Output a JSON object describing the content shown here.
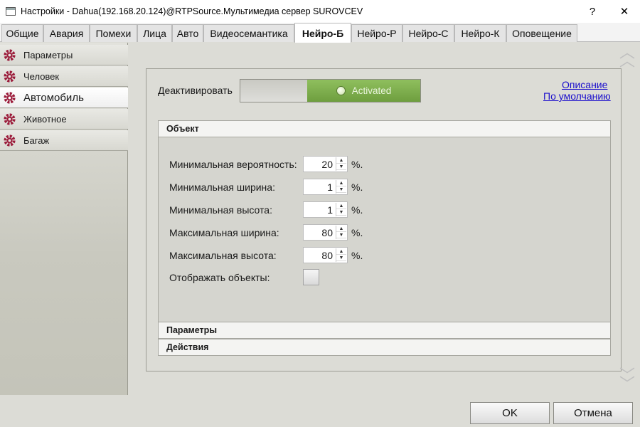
{
  "window": {
    "title": "Настройки - Dahua(192.168.20.124)@RTPSource.Мультимедиа сервер SUROVCEV",
    "help_label": "?",
    "close_label": "✕"
  },
  "tabs": [
    {
      "label": "Общие"
    },
    {
      "label": "Авария"
    },
    {
      "label": "Помехи"
    },
    {
      "label": "Лица"
    },
    {
      "label": "Авто"
    },
    {
      "label": "Видеосемантика"
    },
    {
      "label": "Нейро-Б",
      "active": true
    },
    {
      "label": "Нейро-Р"
    },
    {
      "label": "Нейро-С"
    },
    {
      "label": "Нейро-К"
    },
    {
      "label": "Оповещение"
    }
  ],
  "sidebar": {
    "items": [
      {
        "label": "Параметры"
      },
      {
        "label": "Человек"
      },
      {
        "label": "Автомобиль",
        "active": true
      },
      {
        "label": "Животное"
      },
      {
        "label": "Багаж"
      }
    ],
    "icon": "gear-icon",
    "icon_color": "#9b1b3a"
  },
  "panel": {
    "deactivate_label": "Деактивировать",
    "toggle_state": "Activated",
    "links": {
      "description": "Описание",
      "defaults": "По умолчанию"
    },
    "groups": {
      "object": "Объект",
      "parameters": "Параметры",
      "actions": "Действия"
    },
    "fields": [
      {
        "label": "Минимальная вероятность:",
        "value": "20",
        "unit": "%."
      },
      {
        "label": "Минимальная ширина:",
        "value": "1",
        "unit": "%."
      },
      {
        "label": "Минимальная высота:",
        "value": "1",
        "unit": "%."
      },
      {
        "label": "Максимальная ширина:",
        "value": "80",
        "unit": "%."
      },
      {
        "label": "Максимальная высота:",
        "value": "80",
        "unit": "%."
      }
    ],
    "show_objects": {
      "label": "Отображать объекты:",
      "checked": false
    }
  },
  "buttons": {
    "ok": "OK",
    "cancel": "Отмена"
  },
  "colors": {
    "toggle_on": "#7aab4a",
    "link": "#1a0dcc"
  }
}
